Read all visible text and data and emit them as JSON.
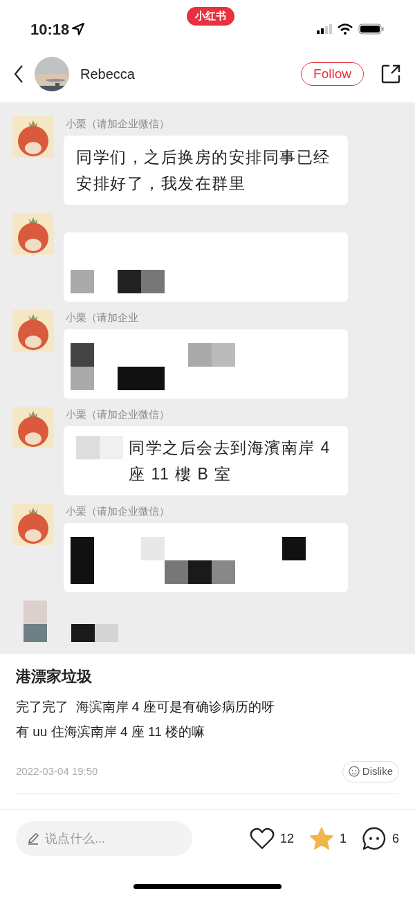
{
  "status_bar": {
    "time": "10:18",
    "app_badge": "小红书"
  },
  "header": {
    "author": "Rebecca",
    "follow_button": "Follow"
  },
  "chat_screenshot": {
    "messages": [
      {
        "kind": "text",
        "sender": "小栗（请加企业微信）",
        "text": "同学们，之后换房的安排同事已经安排好了，我发在群里"
      },
      {
        "kind": "redacted"
      },
      {
        "kind": "redacted",
        "sender": "小栗（请加企业"
      },
      {
        "kind": "mixed",
        "sender": "小栗（请加企业微信）",
        "text": "同学之后会去到海濱南岸 4 座 11 樓 B 室"
      },
      {
        "kind": "redacted",
        "sender": "小栗（请加企业微信）"
      },
      {
        "kind": "cut"
      }
    ]
  },
  "post": {
    "title": "港漂家垃圾",
    "lines": [
      "完了完了  海滨南岸 4 座可是有确诊病历的呀",
      "有 uu 住海滨南岸 4 座 11 楼的嘛"
    ],
    "date": "2022-03-04 19:50",
    "dislike_button": "Dislike"
  },
  "bottom_bar": {
    "comment_placeholder": "说点什么...",
    "likes": "12",
    "liked": false,
    "collects": "1",
    "collected": true,
    "comments": "6"
  }
}
